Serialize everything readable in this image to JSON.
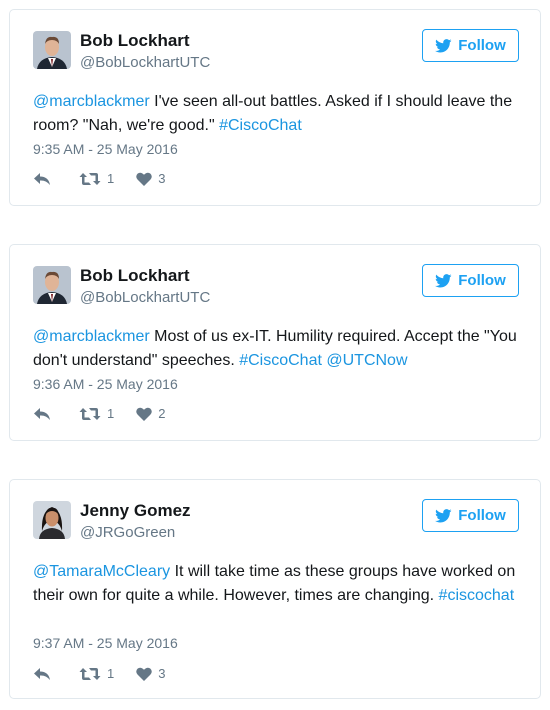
{
  "follow_label": "Follow",
  "colors": {
    "accent": "#1da1f2",
    "link": "#1b95e0",
    "muted": "#657786"
  },
  "tweets": [
    {
      "name": "Bob Lockhart",
      "handle": "@BobLockhartUTC",
      "text_parts": [
        {
          "t": "@marcblackmer",
          "link": true
        },
        {
          "t": " I've seen all-out battles. Asked if I should leave the room? \"Nah, we're good.\" ",
          "link": false
        },
        {
          "t": "#CiscoChat",
          "link": true
        }
      ],
      "timestamp": "9:35 AM - 25 May 2016",
      "retweets": "1",
      "likes": "3"
    },
    {
      "name": "Bob Lockhart",
      "handle": "@BobLockhartUTC",
      "text_parts": [
        {
          "t": "@marcblackmer",
          "link": true
        },
        {
          "t": " Most of us ex-IT. Humility required. Accept the \"You don't understand\" speeches. ",
          "link": false
        },
        {
          "t": "#CiscoChat",
          "link": true
        },
        {
          "t": " ",
          "link": false
        },
        {
          "t": "@UTCNow",
          "link": true
        }
      ],
      "timestamp": "9:36 AM - 25 May 2016",
      "retweets": "1",
      "likes": "2"
    },
    {
      "name": "Jenny Gomez",
      "handle": "@JRGoGreen",
      "text_parts": [
        {
          "t": "@TamaraMcCleary",
          "link": true
        },
        {
          "t": " It will take time as these groups have worked on their own for quite a while. However, times are changing. ",
          "link": false
        },
        {
          "t": "#ciscochat",
          "link": true
        }
      ],
      "timestamp": "9:37 AM - 25 May 2016",
      "retweets": "1",
      "likes": "3"
    }
  ]
}
